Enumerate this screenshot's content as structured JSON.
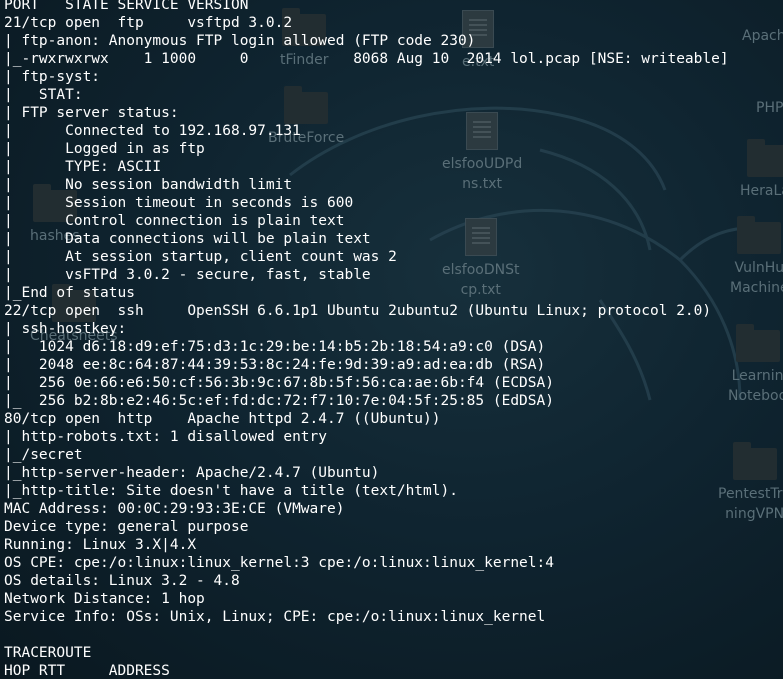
{
  "desktop": {
    "icons": [
      {
        "name": "",
        "kind": "folder"
      },
      {
        "name": "tFinder",
        "kind": "folder"
      },
      {
        "name": "BruteForce",
        "kind": "folder"
      },
      {
        "name": "e.txt",
        "kind": "doc"
      },
      {
        "name": "elsfooUDPdns.txt",
        "kind": "doc",
        "lines": [
          "elsfooUDPd",
          "ns.txt"
        ]
      },
      {
        "name": "elsfooDNStcp.txt",
        "kind": "doc",
        "lines": [
          "elsfooDNSt",
          "cp.txt"
        ]
      },
      {
        "name": "Apach",
        "kind": "folder"
      },
      {
        "name": "PHP",
        "kind": "folder"
      },
      {
        "name": "HeraLab",
        "kind": "folder"
      },
      {
        "name": "VulnHub Machine",
        "kind": "folder",
        "lines": [
          "VulnHu",
          "Machine"
        ]
      },
      {
        "name": "Learning Notebook",
        "kind": "folder",
        "lines": [
          "Learnin",
          "Noteboo"
        ]
      },
      {
        "name": "PentestTrainingVPN",
        "kind": "folder",
        "lines": [
          "PentestTra",
          "ningVPN"
        ]
      },
      {
        "name": "hashes",
        "kind": "folder"
      },
      {
        "name": "Cheatsheets",
        "kind": "folder"
      }
    ]
  },
  "terminal": {
    "lines": [
      "PORT   STATE SERVICE VERSION",
      "21/tcp open  ftp     vsftpd 3.0.2",
      "| ftp-anon: Anonymous FTP login allowed (FTP code 230)",
      "|_-rwxrwxrwx    1 1000     0            8068 Aug 10  2014 lol.pcap [NSE: writeable]",
      "| ftp-syst:",
      "|   STAT:",
      "| FTP server status:",
      "|      Connected to 192.168.97.131",
      "|      Logged in as ftp",
      "|      TYPE: ASCII",
      "|      No session bandwidth limit",
      "|      Session timeout in seconds is 600",
      "|      Control connection is plain text",
      "|      Data connections will be plain text",
      "|      At session startup, client count was 2",
      "|      vsFTPd 3.0.2 - secure, fast, stable",
      "|_End of status",
      "22/tcp open  ssh     OpenSSH 6.6.1p1 Ubuntu 2ubuntu2 (Ubuntu Linux; protocol 2.0)",
      "| ssh-hostkey:",
      "|   1024 d6:18:d9:ef:75:d3:1c:29:be:14:b5:2b:18:54:a9:c0 (DSA)",
      "|   2048 ee:8c:64:87:44:39:53:8c:24:fe:9d:39:a9:ad:ea:db (RSA)",
      "|   256 0e:66:e6:50:cf:56:3b:9c:67:8b:5f:56:ca:ae:6b:f4 (ECDSA)",
      "|_  256 b2:8b:e2:46:5c:ef:fd:dc:72:f7:10:7e:04:5f:25:85 (EdDSA)",
      "80/tcp open  http    Apache httpd 2.4.7 ((Ubuntu))",
      "| http-robots.txt: 1 disallowed entry",
      "|_/secret",
      "|_http-server-header: Apache/2.4.7 (Ubuntu)",
      "|_http-title: Site doesn't have a title (text/html).",
      "MAC Address: 00:0C:29:93:3E:CE (VMware)",
      "Device type: general purpose",
      "Running: Linux 3.X|4.X",
      "OS CPE: cpe:/o:linux:linux_kernel:3 cpe:/o:linux:linux_kernel:4",
      "OS details: Linux 3.2 - 4.8",
      "Network Distance: 1 hop",
      "Service Info: OSs: Unix, Linux; CPE: cpe:/o:linux:linux_kernel",
      "",
      "TRACEROUTE",
      "HOP RTT     ADDRESS"
    ]
  },
  "colors": {
    "terminal_text": "#ffffff",
    "desktop_bg": "#0f2430",
    "desktop_label": "#5a6f78"
  }
}
